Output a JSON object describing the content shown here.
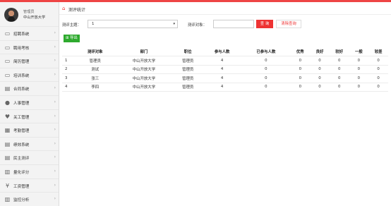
{
  "user": {
    "name": "管理员",
    "org": "中山开放大学"
  },
  "sidebar": {
    "items": [
      {
        "label": "招聘系统",
        "icon": "laptop-icon"
      },
      {
        "label": "聘用考核",
        "icon": "laptop-icon"
      },
      {
        "label": "简历管理",
        "icon": "laptop-icon"
      },
      {
        "label": "培训系统",
        "icon": "laptop-icon"
      },
      {
        "label": "合同系统",
        "icon": "document-icon"
      },
      {
        "label": "人事管理",
        "icon": "person-icon"
      },
      {
        "label": "关工管理",
        "icon": "heart-icon"
      },
      {
        "label": "考勤管理",
        "icon": "calendar-icon"
      },
      {
        "label": "绩效系统",
        "icon": "document-icon"
      },
      {
        "label": "民主测评",
        "icon": "document-icon"
      },
      {
        "label": "量化评分",
        "icon": "bar-chart-icon"
      },
      {
        "label": "工资管理",
        "icon": "yen-icon"
      },
      {
        "label": "监控分析",
        "icon": "bar-chart-icon"
      }
    ]
  },
  "breadcrumb": {
    "title": "测评统计"
  },
  "filter": {
    "subject_label": "测评主题：",
    "subject_value": "1",
    "target_label": "测评对象：",
    "target_value": "",
    "query_label": "查 询",
    "clear_label": "清除查询"
  },
  "toolbar": {
    "export_label": "导出"
  },
  "table": {
    "headers": [
      "",
      "测评对象",
      "部门",
      "职位",
      "参与人数",
      "已参与人数",
      "优秀",
      "良好",
      "较好",
      "一般",
      "较差"
    ],
    "rows": [
      [
        "1",
        "管理员",
        "中山开放大学",
        "管理员",
        "4",
        "0",
        "0",
        "0",
        "0",
        "0",
        "0"
      ],
      [
        "2",
        "测试",
        "中山开放大学",
        "管理员",
        "4",
        "0",
        "0",
        "0",
        "0",
        "0",
        "0"
      ],
      [
        "3",
        "张三",
        "中山开放大学",
        "管理员",
        "4",
        "0",
        "0",
        "0",
        "0",
        "0",
        "0"
      ],
      [
        "4",
        "李四",
        "中山开放大学",
        "管理员",
        "4",
        "0",
        "0",
        "0",
        "0",
        "0",
        "0"
      ]
    ]
  },
  "colors": {
    "accent": "#e33333",
    "export": "#2eaa2e"
  }
}
